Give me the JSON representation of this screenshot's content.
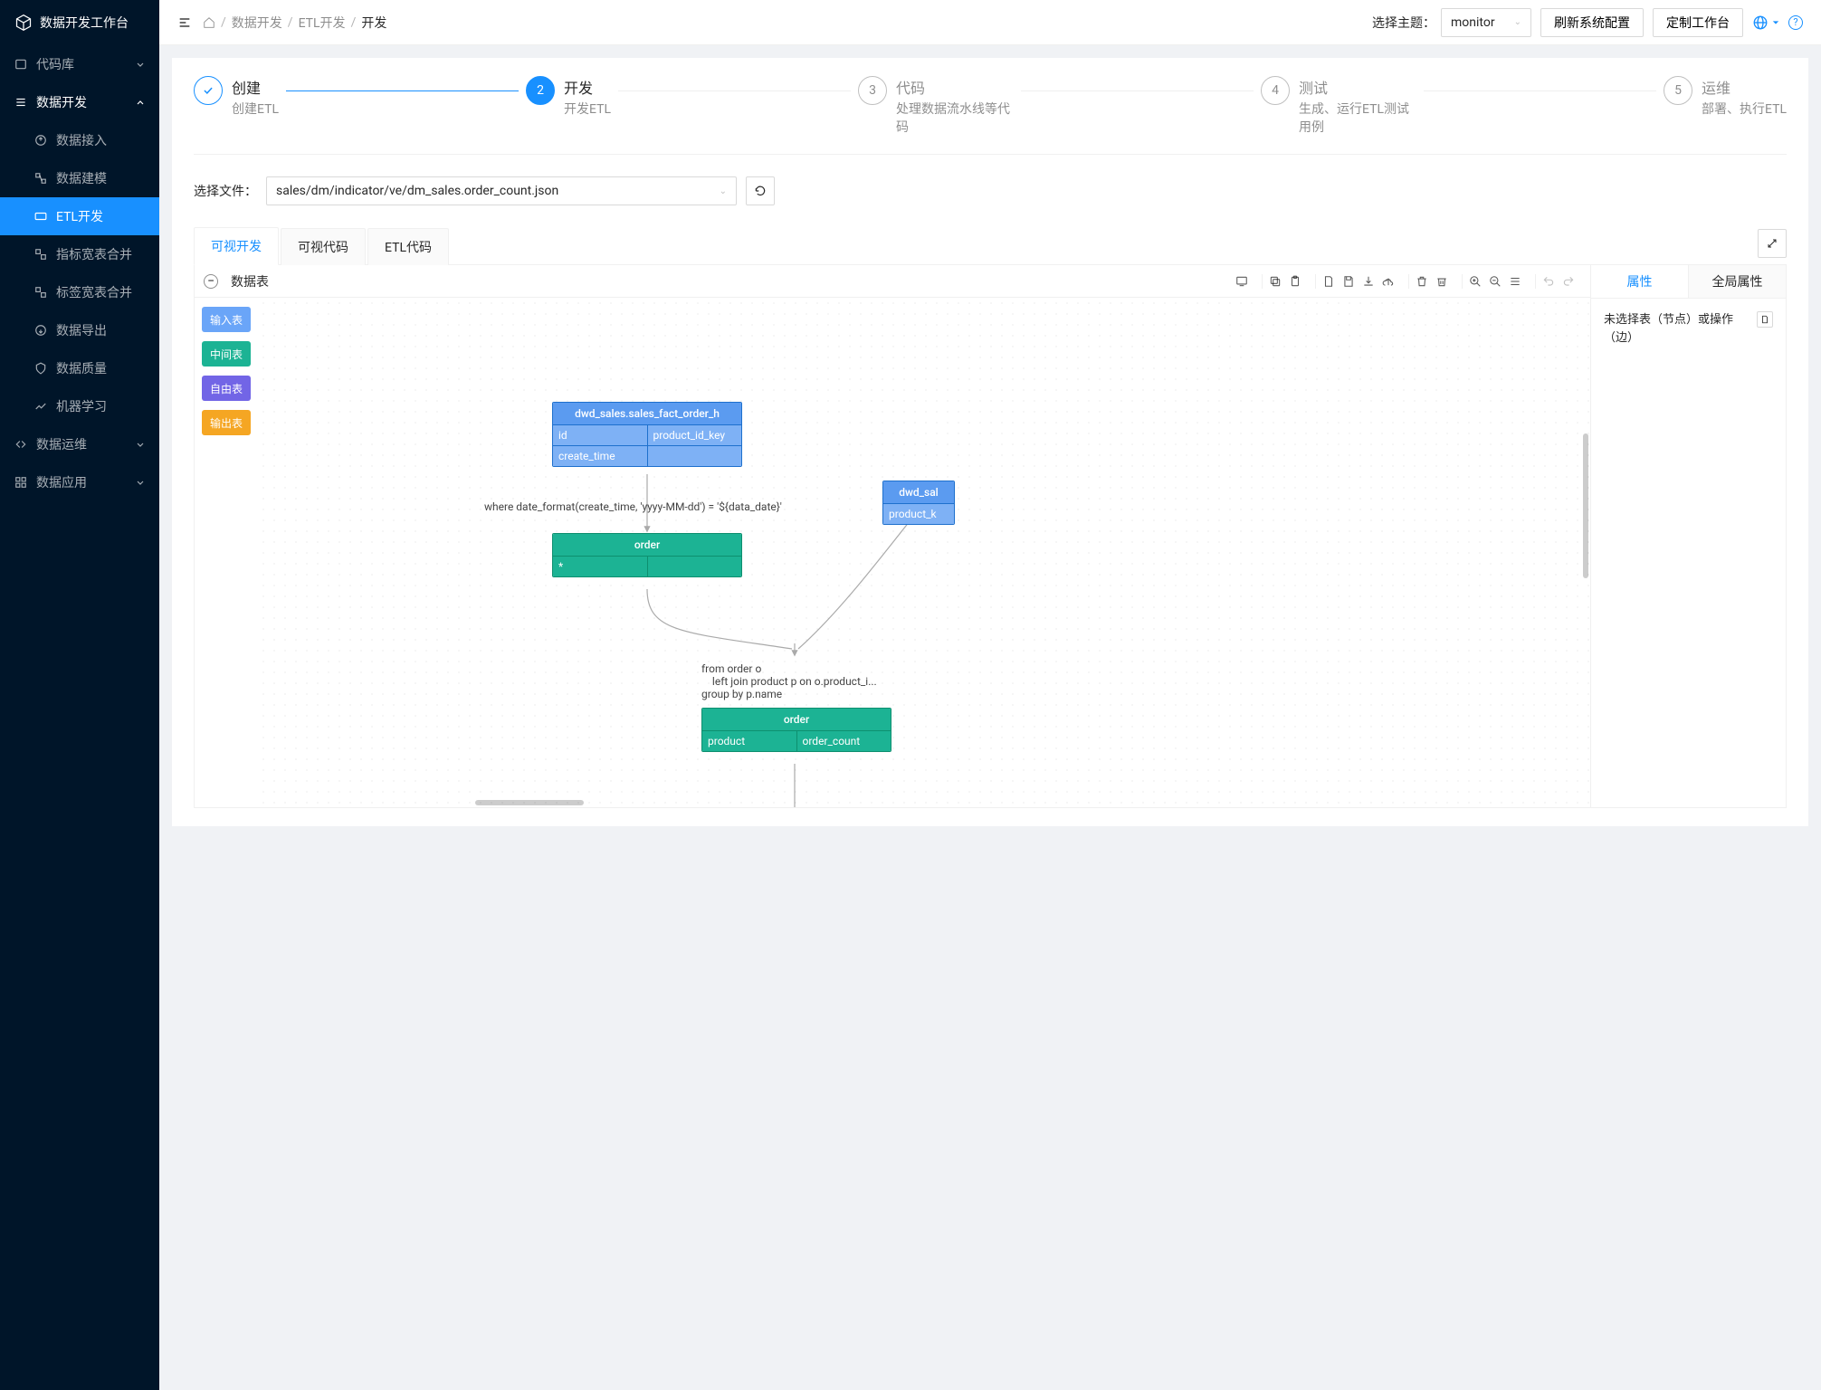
{
  "sidebar": {
    "title": "数据开发工作台",
    "menu": [
      {
        "label": "代码库",
        "expandable": true
      },
      {
        "label": "数据开发",
        "expandable": true,
        "open": true,
        "children": [
          {
            "label": "数据接入"
          },
          {
            "label": "数据建模"
          },
          {
            "label": "ETL开发",
            "active": true
          },
          {
            "label": "指标宽表合并"
          },
          {
            "label": "标签宽表合并"
          },
          {
            "label": "数据导出"
          },
          {
            "label": "数据质量"
          },
          {
            "label": "机器学习"
          }
        ]
      },
      {
        "label": "数据运维",
        "expandable": true
      },
      {
        "label": "数据应用",
        "expandable": true
      }
    ]
  },
  "header": {
    "breadcrumb": [
      "数据开发",
      "ETL开发",
      "开发"
    ],
    "theme_label": "选择主题：",
    "theme_value": "monitor",
    "btn_refresh": "刷新系统配置",
    "btn_custom": "定制工作台"
  },
  "steps": [
    {
      "num": "✓",
      "title": "创建",
      "desc": "创建ETL",
      "state": "finish"
    },
    {
      "num": "2",
      "title": "开发",
      "desc": "开发ETL",
      "state": "process"
    },
    {
      "num": "3",
      "title": "代码",
      "desc": "处理数据流水线等代码",
      "state": "wait"
    },
    {
      "num": "4",
      "title": "测试",
      "desc": "生成、运行ETL测试用例",
      "state": "wait"
    },
    {
      "num": "5",
      "title": "运维",
      "desc": "部署、执行ETL",
      "state": "wait"
    }
  ],
  "file": {
    "label": "选择文件：",
    "value": "sales/dm/indicator/ve/dm_sales.order_count.json"
  },
  "tabs": [
    "可视开发",
    "可视代码",
    "ETL代码"
  ],
  "active_tab": 0,
  "toolbar_label": "数据表",
  "palette": {
    "input": "输入表",
    "mid": "中间表",
    "free": "自由表",
    "out": "输出表"
  },
  "graph": {
    "node1": {
      "title": "dwd_sales.sales_fact_order_h",
      "cells": [
        [
          "id",
          "product_id_key"
        ],
        [
          "create_time",
          ""
        ]
      ]
    },
    "node2": {
      "title": "dwd_sal",
      "cells": [
        [
          "product_k"
        ]
      ]
    },
    "node3": {
      "title": "order",
      "cells": [
        [
          "*",
          ""
        ]
      ]
    },
    "node4": {
      "title": "order",
      "cells": [
        [
          "product",
          "order_count"
        ]
      ]
    },
    "edge1_label": "where date_format(create_time, 'yyyy-MM-dd') = '${data_date}'",
    "edge2_label": "from order o\n    left join product p on o.product_i...\ngroup by p.name"
  },
  "props": {
    "tabs": [
      "属性",
      "全局属性"
    ],
    "empty_text": "未选择表（节点）或操作（边）"
  }
}
